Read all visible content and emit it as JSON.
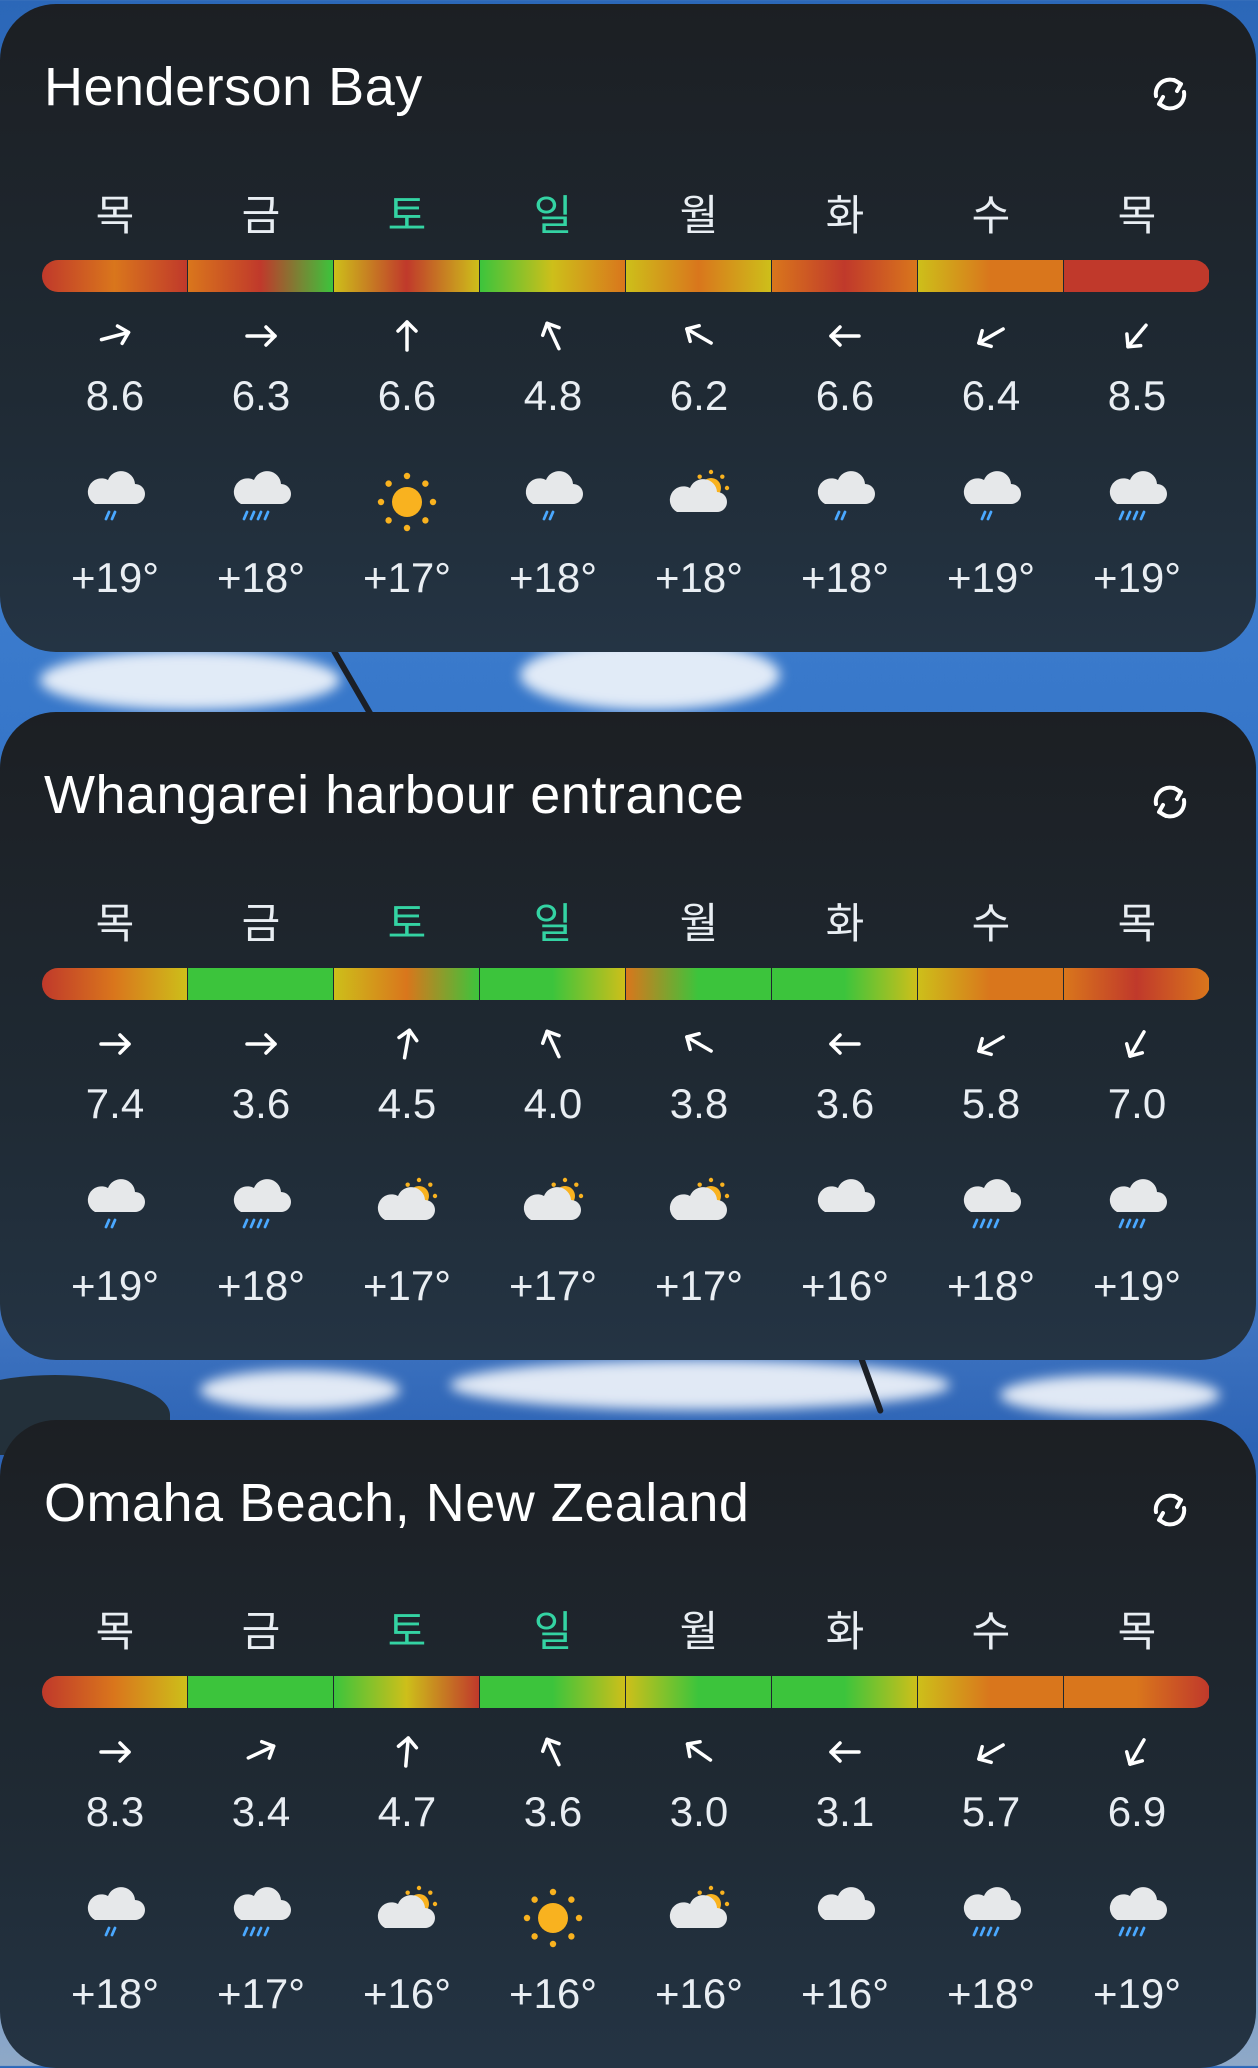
{
  "colors": {
    "red": "#c0392b",
    "orange": "#d9761c",
    "yellow": "#cdbf1a",
    "green": "#3cc43c",
    "weekend_day": "#34d3a3",
    "text": "#e9eef3",
    "card_bg": "#1c1f23",
    "sun": "#f9b21f",
    "cloud": "#e6e8ea",
    "rain": "#4aa8ff"
  },
  "refresh_icon": "refresh-icon",
  "cards": [
    {
      "title": "Henderson Bay",
      "days": [
        {
          "label": "목",
          "weekend": false
        },
        {
          "label": "금",
          "weekend": false
        },
        {
          "label": "토",
          "weekend": true
        },
        {
          "label": "일",
          "weekend": true
        },
        {
          "label": "월",
          "weekend": false
        },
        {
          "label": "화",
          "weekend": false
        },
        {
          "label": "수",
          "weekend": false
        },
        {
          "label": "목",
          "weekend": false
        }
      ],
      "bar": [
        [
          "red",
          "orange",
          "red"
        ],
        [
          "orange",
          "red",
          "green"
        ],
        [
          "yellow",
          "red",
          "yellow"
        ],
        [
          "green",
          "yellow",
          "orange"
        ],
        [
          "yellow",
          "orange",
          "yellow"
        ],
        [
          "orange",
          "red",
          "orange"
        ],
        [
          "yellow",
          "orange",
          "orange"
        ],
        [
          "red",
          "red",
          "red"
        ]
      ],
      "wind_dirs": [
        75,
        90,
        0,
        -25,
        -60,
        -90,
        -120,
        -140
      ],
      "winds": [
        "8.6",
        "6.3",
        "6.6",
        "4.8",
        "6.2",
        "6.6",
        "6.4",
        "8.5"
      ],
      "weather": [
        "cloud-light-rain",
        "cloud-rain",
        "sun",
        "cloud-light-rain",
        "cloud-sun",
        "cloud-light-rain",
        "cloud-light-rain",
        "cloud-rain"
      ],
      "temps": [
        "+19°",
        "+18°",
        "+17°",
        "+18°",
        "+18°",
        "+18°",
        "+19°",
        "+19°"
      ]
    },
    {
      "title": "Whangarei harbour entrance",
      "days": [
        {
          "label": "목",
          "weekend": false
        },
        {
          "label": "금",
          "weekend": false
        },
        {
          "label": "토",
          "weekend": true
        },
        {
          "label": "일",
          "weekend": true
        },
        {
          "label": "월",
          "weekend": false
        },
        {
          "label": "화",
          "weekend": false
        },
        {
          "label": "수",
          "weekend": false
        },
        {
          "label": "목",
          "weekend": false
        }
      ],
      "bar": [
        [
          "red",
          "orange",
          "yellow"
        ],
        [
          "green",
          "green",
          "green"
        ],
        [
          "yellow",
          "orange",
          "green"
        ],
        [
          "green",
          "green",
          "yellow"
        ],
        [
          "orange",
          "green",
          "green"
        ],
        [
          "green",
          "green",
          "yellow"
        ],
        [
          "yellow",
          "orange",
          "orange"
        ],
        [
          "orange",
          "red",
          "orange"
        ]
      ],
      "wind_dirs": [
        90,
        90,
        10,
        -25,
        -60,
        -90,
        -120,
        -150
      ],
      "winds": [
        "7.4",
        "3.6",
        "4.5",
        "4.0",
        "3.8",
        "3.6",
        "5.8",
        "7.0"
      ],
      "weather": [
        "cloud-light-rain",
        "cloud-rain",
        "cloud-sun",
        "cloud-sun",
        "cloud-sun",
        "cloud",
        "cloud-rain",
        "cloud-rain"
      ],
      "temps": [
        "+19°",
        "+18°",
        "+17°",
        "+17°",
        "+17°",
        "+16°",
        "+18°",
        "+19°"
      ]
    },
    {
      "title": "Omaha Beach, New Zealand",
      "days": [
        {
          "label": "목",
          "weekend": false
        },
        {
          "label": "금",
          "weekend": false
        },
        {
          "label": "토",
          "weekend": true
        },
        {
          "label": "일",
          "weekend": true
        },
        {
          "label": "월",
          "weekend": false
        },
        {
          "label": "화",
          "weekend": false
        },
        {
          "label": "수",
          "weekend": false
        },
        {
          "label": "목",
          "weekend": false
        }
      ],
      "bar": [
        [
          "red",
          "orange",
          "yellow"
        ],
        [
          "green",
          "green",
          "green"
        ],
        [
          "green",
          "yellow",
          "red"
        ],
        [
          "green",
          "green",
          "yellow"
        ],
        [
          "yellow",
          "green",
          "green"
        ],
        [
          "green",
          "green",
          "yellow"
        ],
        [
          "yellow",
          "orange",
          "orange"
        ],
        [
          "orange",
          "orange",
          "red"
        ]
      ],
      "wind_dirs": [
        90,
        65,
        5,
        -25,
        -55,
        -90,
        -120,
        -150
      ],
      "winds": [
        "8.3",
        "3.4",
        "4.7",
        "3.6",
        "3.0",
        "3.1",
        "5.7",
        "6.9"
      ],
      "weather": [
        "cloud-light-rain",
        "cloud-rain",
        "cloud-sun",
        "sun",
        "cloud-sun",
        "cloud",
        "cloud-rain",
        "cloud-rain"
      ],
      "temps": [
        "+18°",
        "+17°",
        "+16°",
        "+16°",
        "+16°",
        "+16°",
        "+18°",
        "+19°"
      ]
    }
  ]
}
